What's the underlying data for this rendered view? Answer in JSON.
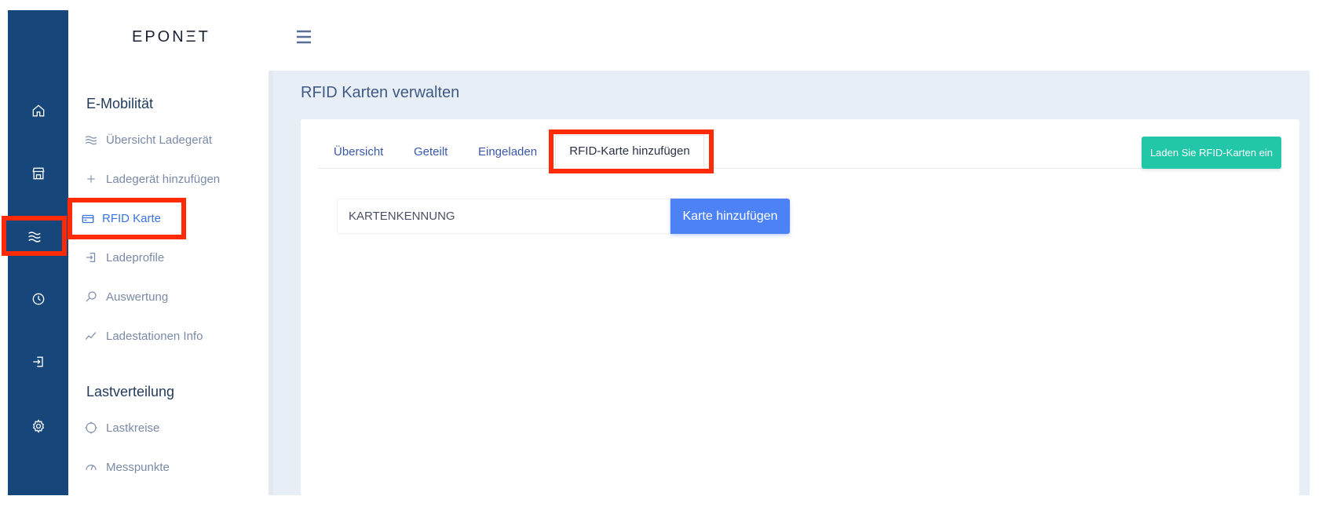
{
  "brand": {
    "logo": "EPONΞT"
  },
  "sidebar": {
    "sections": [
      {
        "title": "E-Mobilität"
      },
      {
        "title": "Lastverteilung"
      }
    ],
    "items": [
      {
        "label": "Übersicht Ladegerät",
        "icon": "waves-icon"
      },
      {
        "label": "Ladegerät hinzufügen",
        "icon": "plus-icon"
      },
      {
        "label": "RFID Karte",
        "icon": "card-icon",
        "active": true
      },
      {
        "label": "Ladeprofile",
        "icon": "login-icon"
      },
      {
        "label": "Auswertung",
        "icon": "search-icon"
      },
      {
        "label": "Ladestationen Info",
        "icon": "chart-line-icon"
      },
      {
        "label": "Lastkreise",
        "icon": "circle-icon"
      },
      {
        "label": "Messpunkte",
        "icon": "gauge-icon"
      }
    ]
  },
  "rail": {
    "icons": [
      "home-icon",
      "store-icon",
      "waves-icon",
      "clock-icon",
      "login-icon",
      "gear-icon"
    ],
    "active": "waves-icon"
  },
  "main": {
    "page_title": "RFID Karten verwalten",
    "tabs": [
      {
        "label": "Übersicht"
      },
      {
        "label": "Geteilt"
      },
      {
        "label": "Eingeladen"
      },
      {
        "label": "RFID-Karte hinzufügen",
        "active": true
      }
    ],
    "load_button": "Laden Sie RFID-Karten ein",
    "card_input_placeholder": "KARTENKENNUNG",
    "add_button": "Karte hinzufügen"
  },
  "colors": {
    "rail_bg": "#16467a",
    "highlight": "#ff2a06",
    "accent_blue": "#4c82f5",
    "accent_green": "#21c7a8",
    "main_bg": "#e8eef6"
  }
}
